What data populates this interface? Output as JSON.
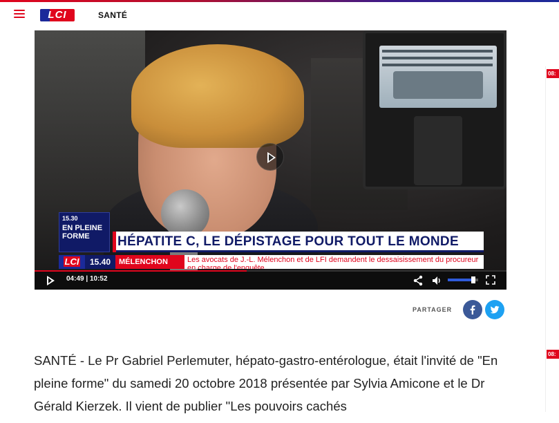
{
  "header": {
    "logo_text": "LCI",
    "section": "SANTÉ"
  },
  "side_rail": {
    "tags": [
      "08:",
      "08:"
    ]
  },
  "video": {
    "program_time": "15.30",
    "program_name": "EN PLEINE FORME",
    "headline": "HÉPATITE C, LE DÉPISTAGE POUR TOUT LE MONDE",
    "ticker": {
      "logo": "LCI",
      "time": "15.40",
      "topic": "MÉLENCHON",
      "text": "Les avocats de J.-L. Mélenchon et de LFI demandent le dessaisissement du procureur en charge de l'enquête"
    },
    "controls": {
      "current_time": "04:49",
      "duration": "10:52",
      "time_separator": "|",
      "progress": 0.45,
      "volume": 0.85
    }
  },
  "share": {
    "label": "PARTAGER",
    "facebook_icon": "facebook-icon",
    "twitter_icon": "twitter-icon",
    "facebook_color": "#3b5998",
    "twitter_color": "#1da1f2"
  },
  "article": {
    "kicker": "SANTÉ",
    "body": " - Le Pr Gabriel Perlemuter, hépato-gastro-entérologue, était l'invité de \"En pleine forme\" du samedi 20 octobre 2018 présentée par Sylvia Amicone et le Dr Gérald Kierzek. Il vient de publier \"Les pouvoirs cachés"
  },
  "colors": {
    "brand_red": "#e0051d",
    "brand_blue": "#101a66"
  }
}
